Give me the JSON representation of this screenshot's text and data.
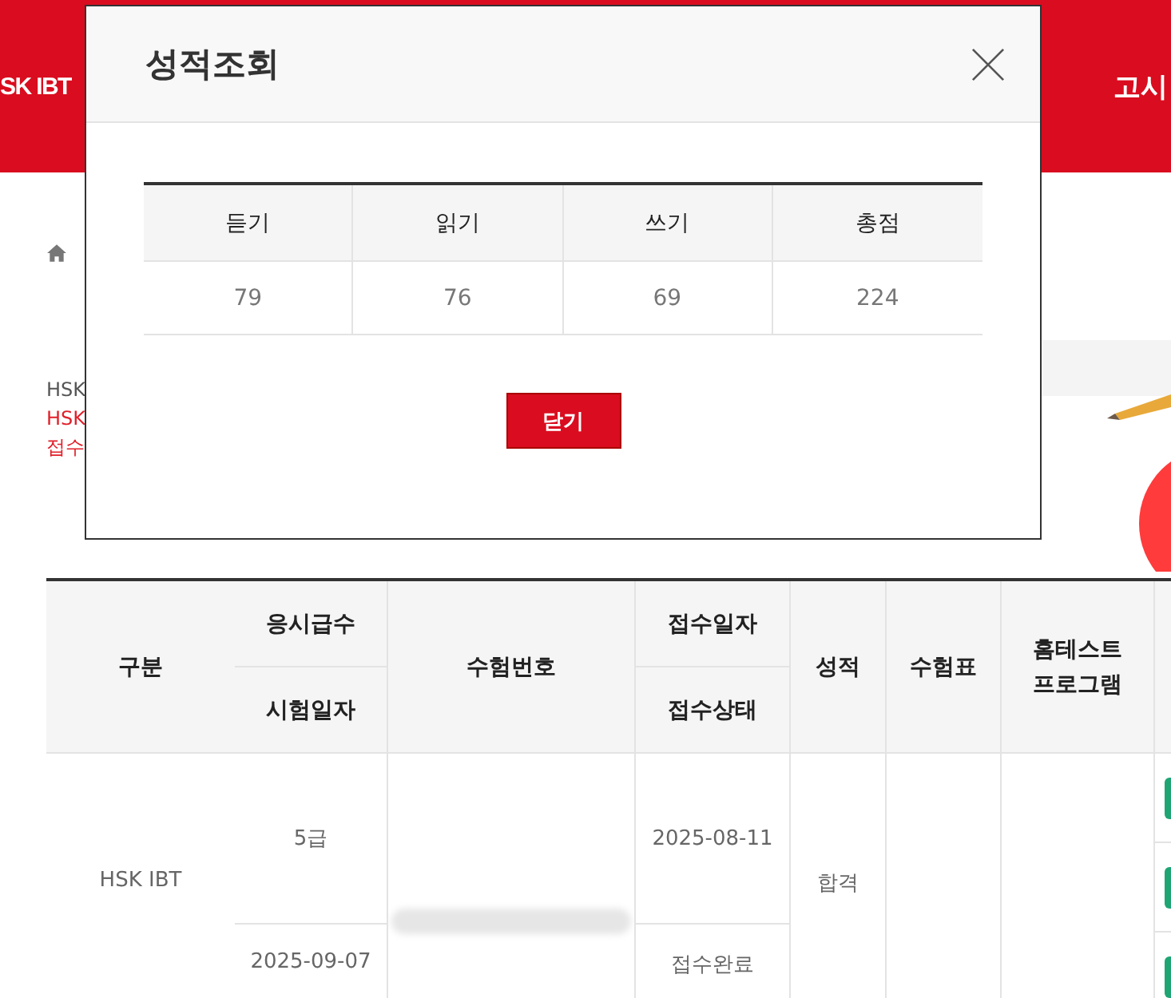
{
  "header": {
    "brand": "SK IBT",
    "menu_item": "고시"
  },
  "notices": [
    {
      "text": "HSK",
      "kind": "plain"
    },
    {
      "text": "HSK",
      "kind": "alert"
    },
    {
      "text": "접수",
      "kind": "alert"
    }
  ],
  "table": {
    "columns": [
      [
        "구분"
      ],
      [
        "응시급수",
        "시험일자"
      ],
      [
        "수험번호"
      ],
      [
        "접수일자",
        "접수상태"
      ],
      [
        "성적"
      ],
      [
        "수험표"
      ],
      [
        "홈테스트 프로그램"
      ]
    ],
    "rows": [
      {
        "category": "HSK IBT",
        "grade": "5급",
        "exam_date": "2025-09-07",
        "applied_on": "2025-08-11",
        "status": "접수완료",
        "result": "합격"
      }
    ]
  },
  "modal": {
    "title": "성적조회",
    "columns": [
      "듣기",
      "읽기",
      "쓰기",
      "총점"
    ],
    "scores": [
      "79",
      "76",
      "69",
      "224"
    ],
    "close_button": "닫기"
  }
}
